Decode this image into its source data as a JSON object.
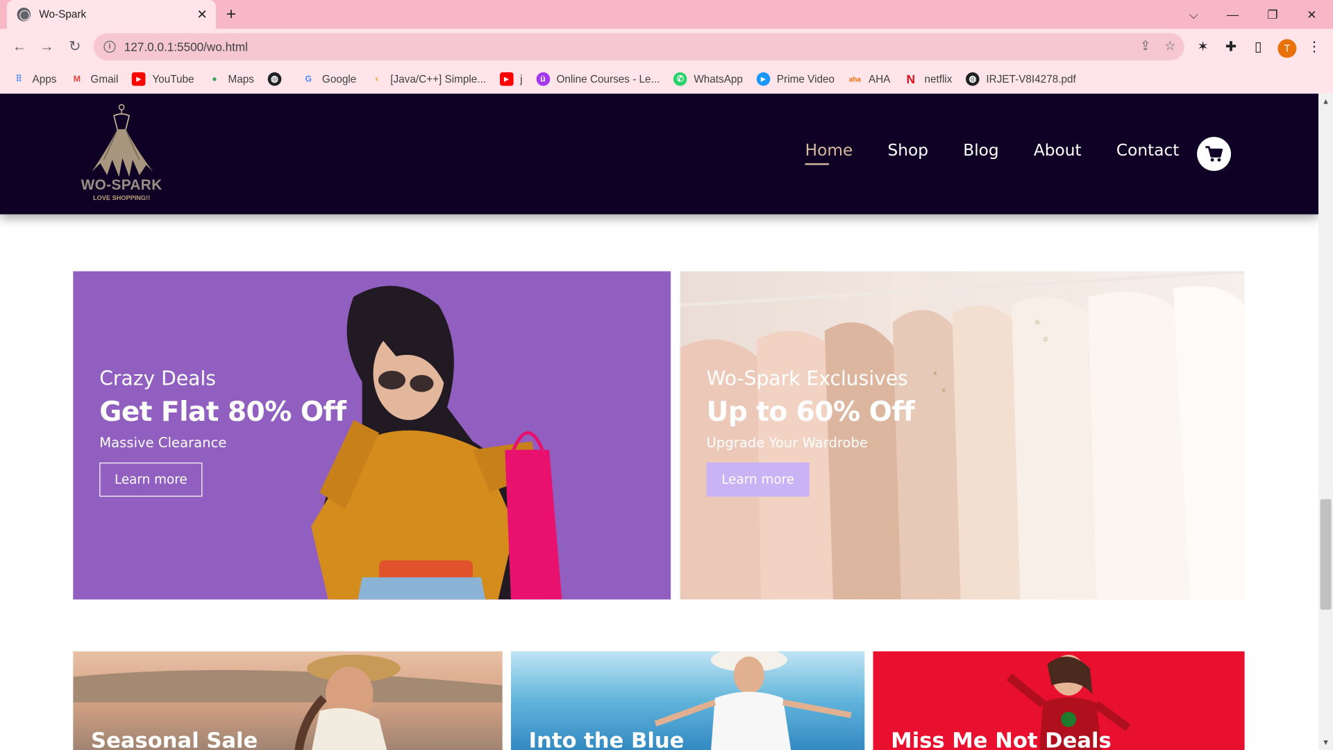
{
  "browser": {
    "tab_title": "Wo-Spark",
    "url": "127.0.0.1:5500/wo.html",
    "profile_initial": "T",
    "bookmarks": [
      "Apps",
      "Gmail",
      "YouTube",
      "Maps",
      "",
      "Google",
      "[Java/C++] Simple...",
      "j",
      "Online Courses - Le...",
      "WhatsApp",
      "Prime Video",
      "AHA",
      "netflix",
      "IRJET-V8I4278.pdf"
    ]
  },
  "site": {
    "brand": "WO-SPARK",
    "tagline": "LOVE SHOPPING!!",
    "nav": [
      "Home",
      "Shop",
      "Blog",
      "About",
      "Contact"
    ],
    "active_nav": "Home"
  },
  "banners": [
    {
      "small": "Crazy Deals",
      "big": "Get Flat 80% Off",
      "sub": "Massive Clearance",
      "button": "Learn more"
    },
    {
      "small": "Wo-Spark Exclusives",
      "big": "Up to 60% Off",
      "sub": "Upgrade Your Wardrobe",
      "button": "Learn more"
    }
  ],
  "cards": [
    "Seasonal Sale",
    "Into the Blue",
    "Miss Me Not Deals"
  ],
  "colors": {
    "header_bg": "#0f0125",
    "banner1_bg": "#915fbf",
    "button_fill": "#c9b3f5",
    "card3_bg": "#e8102e",
    "chrome_pink": "#f7b7c6"
  }
}
